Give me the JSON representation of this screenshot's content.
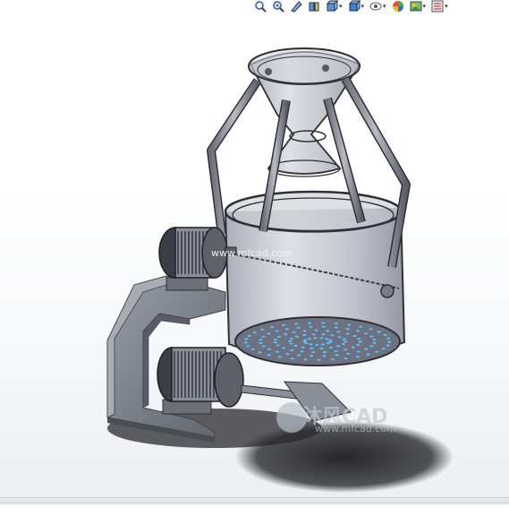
{
  "toolbar": {
    "items": [
      {
        "icon": "zoom-to-fit-icon",
        "dropdown": false
      },
      {
        "icon": "zoom-to-area-icon",
        "dropdown": false
      },
      {
        "icon": "previous-view-icon",
        "dropdown": false
      },
      {
        "icon": "section-view-icon",
        "dropdown": false
      },
      {
        "icon": "view-orientation-icon",
        "dropdown": true
      },
      {
        "icon": "display-style-icon",
        "dropdown": true
      },
      {
        "icon": "hide-show-items-icon",
        "dropdown": true
      },
      {
        "icon": "edit-appearance-icon",
        "dropdown": false
      },
      {
        "icon": "apply-scene-icon",
        "dropdown": true
      },
      {
        "icon": "view-settings-icon",
        "dropdown": true
      }
    ],
    "dropdown_glyph": "▾"
  },
  "watermarks": {
    "top_url": "www.mfcad.com",
    "logo_text": "沐风CAD",
    "logo_url": "www.mfcad.com"
  },
  "colors": {
    "steel": "#7c8089",
    "steel_dark": "#4f535b",
    "glass": "#b9bcc6",
    "glass_edge": "#2e3036",
    "hole": "#57c8ff",
    "shadow": "#1d1d20"
  }
}
